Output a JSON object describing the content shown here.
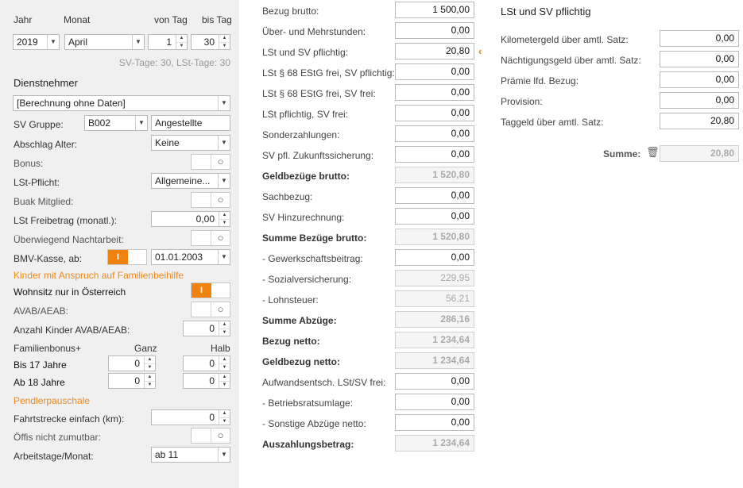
{
  "period": {
    "jahr_label": "Jahr",
    "monat_label": "Monat",
    "von_tag_label": "von Tag",
    "bis_tag_label": "bis Tag",
    "jahr": "2019",
    "monat": "April",
    "von_tag": "1",
    "bis_tag": "30",
    "tage_info": "SV-Tage: 30,  LSt-Tage: 30"
  },
  "dienstnehmer": {
    "heading": "Dienstnehmer",
    "berechnung": "[Berechnung ohne Daten]",
    "sv_gruppe_label": "SV Gruppe:",
    "sv_gruppe_code": "B002",
    "sv_gruppe_text": "Angestellte",
    "abschlag_alter_label": "Abschlag Alter:",
    "abschlag_alter": "Keine",
    "bonus_label": "Bonus:",
    "lst_pflicht_label": "LSt-Pflicht:",
    "lst_pflicht": "Allgemeine...",
    "buak_label": "Buak Mitglied:",
    "lst_freibetrag_label": "LSt Freibetrag (monatl.):",
    "lst_freibetrag": "0,00",
    "nachtarbeit_label": "Überwiegend Nachtarbeit:",
    "bmv_label": "BMV-Kasse, ab:",
    "bmv_toggle": "I",
    "bmv_datum": "01.01.2003"
  },
  "kinder": {
    "heading": "Kinder mit Anspruch auf Familienbeihilfe",
    "wohnsitz_label": "Wohnsitz nur in Österreich",
    "wohnsitz_toggle": "I",
    "avab_label": "AVAB/AEAB:",
    "anzahl_label": "Anzahl Kinder AVAB/AEAB:",
    "anzahl": "0",
    "familienbonus_label": "Familienbonus+",
    "ganz_label": "Ganz",
    "halb_label": "Halb",
    "bis17_label": "Bis 17 Jahre",
    "bis17_ganz": "0",
    "bis17_halb": "0",
    "ab18_label": "Ab 18 Jahre",
    "ab18_ganz": "0",
    "ab18_halb": "0"
  },
  "pendler": {
    "heading": "Pendlerpauschale",
    "fahrtstrecke_label": "Fahrtstrecke einfach (km):",
    "fahrtstrecke": "0",
    "oeffis_label": "Öffis nicht zumutbar:",
    "arbeitstage_label": "Arbeitstage/Monat:",
    "arbeitstage": "ab 11"
  },
  "calc": {
    "rows": [
      {
        "label": "Bezug brutto:",
        "value": "1 500,00"
      },
      {
        "label": "Über- und Mehrstunden:",
        "value": "0,00"
      },
      {
        "label": "LSt und SV pflichtig:",
        "value": "20,80"
      },
      {
        "label": "LSt § 68 EStG frei, SV pflichtig:",
        "value": "0,00"
      },
      {
        "label": "LSt § 68 EStG frei, SV frei:",
        "value": "0,00"
      },
      {
        "label": "LSt pflichtig, SV frei:",
        "value": "0,00"
      },
      {
        "label": "Sonderzahlungen:",
        "value": "0,00"
      },
      {
        "label": "SV pfl. Zukunftssicherung:",
        "value": "0,00"
      },
      {
        "label": "Geldbezüge brutto:",
        "value": "1 520,80"
      },
      {
        "label": "Sachbezug:",
        "value": "0,00"
      },
      {
        "label": "SV Hinzurechnung:",
        "value": "0,00"
      },
      {
        "label": "Summe Bezüge brutto:",
        "value": "1 520,80"
      },
      {
        "label": "- Gewerkschaftsbeitrag:",
        "value": "0,00"
      },
      {
        "label": "- Sozialversicherung:",
        "value": "229,95"
      },
      {
        "label": "- Lohnsteuer:",
        "value": "56,21"
      },
      {
        "label": "Summe Abzüge:",
        "value": "286,16"
      },
      {
        "label": "Bezug netto:",
        "value": "1 234,64"
      },
      {
        "label": "Geldbezug netto:",
        "value": "1 234,64"
      },
      {
        "label": "Aufwandsentsch. LSt/SV frei:",
        "value": "0,00"
      },
      {
        "label": "- Betriebsratsumlage:",
        "value": "0,00"
      },
      {
        "label": "- Sonstige Abzüge netto:",
        "value": "0,00"
      },
      {
        "label": "Auszahlungsbetrag:",
        "value": "1 234,64"
      }
    ]
  },
  "detail": {
    "heading": "LSt und SV pflichtig",
    "rows": [
      {
        "label": "Kilometergeld über amtl. Satz:",
        "value": "0,00"
      },
      {
        "label": "Nächtigungsgeld über amtl. Satz:",
        "value": "0,00"
      },
      {
        "label": "Prämie lfd. Bezug:",
        "value": "0,00"
      },
      {
        "label": "Provision:",
        "value": "0,00"
      },
      {
        "label": "Taggeld über amtl. Satz:",
        "value": "20,80"
      }
    ],
    "summe_label": "Summe:",
    "summe_value": "20,80"
  },
  "colors": {
    "accent": "#f0820f",
    "panel": "#f0f0f0"
  }
}
